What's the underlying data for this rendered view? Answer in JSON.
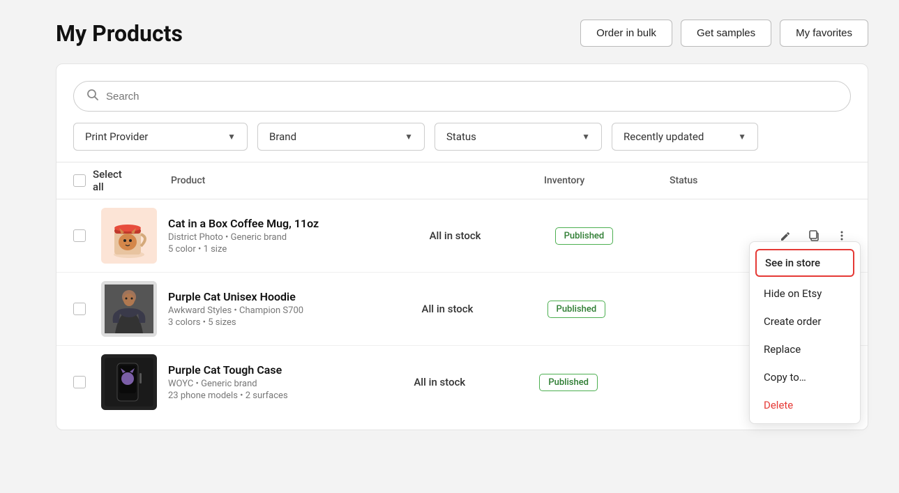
{
  "page": {
    "title": "My Products"
  },
  "header": {
    "buttons": [
      {
        "id": "order-bulk",
        "label": "Order in bulk"
      },
      {
        "id": "get-samples",
        "label": "Get samples"
      },
      {
        "id": "my-favorites",
        "label": "My favorites"
      }
    ]
  },
  "search": {
    "placeholder": "Search"
  },
  "filters": [
    {
      "id": "print-provider",
      "label": "Print Provider"
    },
    {
      "id": "brand",
      "label": "Brand"
    },
    {
      "id": "status",
      "label": "Status"
    },
    {
      "id": "recently-updated",
      "label": "Recently updated"
    }
  ],
  "table": {
    "select_all_label": "Select all",
    "columns": {
      "product": "Product",
      "inventory": "Inventory",
      "status": "Status"
    },
    "rows": [
      {
        "id": "row-1",
        "name": "Cat in a Box Coffee Mug, 11oz",
        "provider": "District Photo",
        "brand": "Generic brand",
        "variants": "5 color • 1 size",
        "inventory": "All in stock",
        "status": "Published",
        "img_type": "mug"
      },
      {
        "id": "row-2",
        "name": "Purple Cat Unisex Hoodie",
        "provider": "Awkward Styles",
        "brand": "Champion S700",
        "variants": "3 colors • 5 sizes",
        "inventory": "All in stock",
        "status": "Published",
        "img_type": "hoodie"
      },
      {
        "id": "row-3",
        "name": "Purple Cat Tough Case",
        "provider": "WOYC",
        "brand": "Generic brand",
        "variants": "23 phone models • 2 surfaces",
        "inventory": "All in stock",
        "status": "Published",
        "img_type": "case"
      }
    ]
  },
  "context_menu": {
    "visible": true,
    "row_index": 0,
    "items": [
      {
        "id": "see-in-store",
        "label": "See in store",
        "style": "highlighted"
      },
      {
        "id": "hide-on-etsy",
        "label": "Hide on Etsy",
        "style": "normal"
      },
      {
        "id": "create-order",
        "label": "Create order",
        "style": "normal"
      },
      {
        "id": "replace",
        "label": "Replace",
        "style": "normal"
      },
      {
        "id": "copy-to",
        "label": "Copy to…",
        "style": "normal"
      },
      {
        "id": "delete",
        "label": "Delete",
        "style": "delete"
      }
    ]
  },
  "icons": {
    "search": "🔍",
    "chevron_down": "▼",
    "edit": "✏",
    "copy": "⧉",
    "more": "⋮"
  }
}
